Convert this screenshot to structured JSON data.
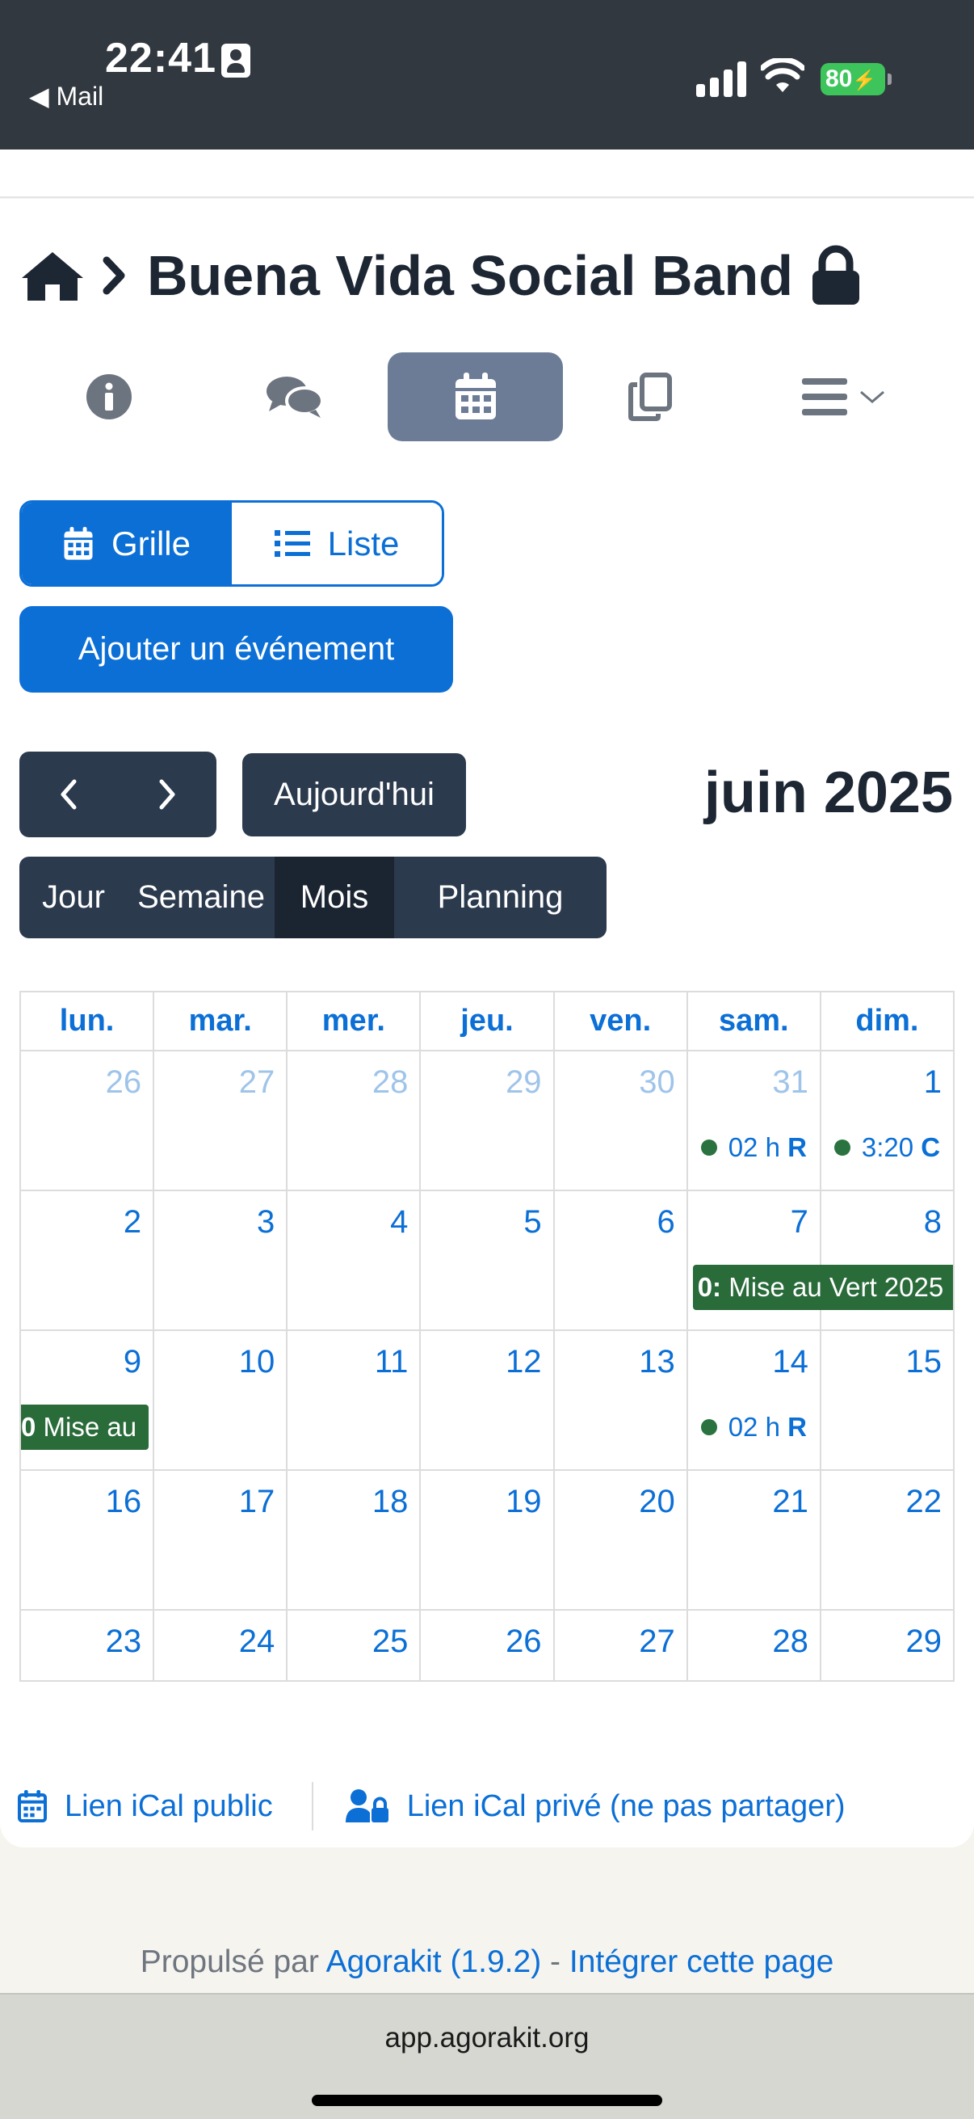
{
  "statusbar": {
    "time": "22:41",
    "back_label": "◀ Mail",
    "battery": "80"
  },
  "header": {
    "group_title": "Buena Vida Social Band",
    "breadcrumb_separator": "›"
  },
  "toolbar": {
    "grid_label": "Grille",
    "list_label": "Liste",
    "add_event_label": "Ajouter un événement",
    "today_label": "Aujourd'hui",
    "month_title": "juin 2025"
  },
  "views": [
    {
      "label": "Jour"
    },
    {
      "label": "Semaine"
    },
    {
      "label": "Mois"
    },
    {
      "label": "Planning"
    }
  ],
  "calendar": {
    "weekdays": [
      "lun.",
      "mar.",
      "mer.",
      "jeu.",
      "ven.",
      "sam.",
      "dim."
    ],
    "weeks": [
      [
        "26",
        "27",
        "28",
        "29",
        "30",
        "31",
        "1"
      ],
      [
        "2",
        "3",
        "4",
        "5",
        "6",
        "7",
        "8"
      ],
      [
        "9",
        "10",
        "11",
        "12",
        "13",
        "14",
        "15"
      ],
      [
        "16",
        "17",
        "18",
        "19",
        "20",
        "21",
        "22"
      ],
      [
        "23",
        "24",
        "25",
        "26",
        "27",
        "28",
        "29"
      ]
    ],
    "events": {
      "may31": {
        "time": "02 h",
        "title": "R"
      },
      "jun1": {
        "time": "3:20",
        "title": "C"
      },
      "jun7_bar": {
        "time": "0:",
        "title": "Mise au Vert 2025"
      },
      "jun9_bar": {
        "time": "0",
        "title": "Mise au"
      },
      "jun14": {
        "time": "02 h",
        "title": "R"
      }
    },
    "event_color": "#2a6b3a"
  },
  "ical": {
    "public_label": "Lien iCal public",
    "private_label": "Lien iCal privé (ne pas partager)"
  },
  "footer": {
    "powered_by": "Propulsé par",
    "app_link": "Agorakit (1.9.2)",
    "dash": "-",
    "embed_link": "Intégrer cette page"
  },
  "browser": {
    "url": "app.agorakit.org"
  },
  "colors": {
    "primary": "#0b6fd6",
    "dark": "#2c3a4e",
    "event_green": "#2a6b3a"
  }
}
